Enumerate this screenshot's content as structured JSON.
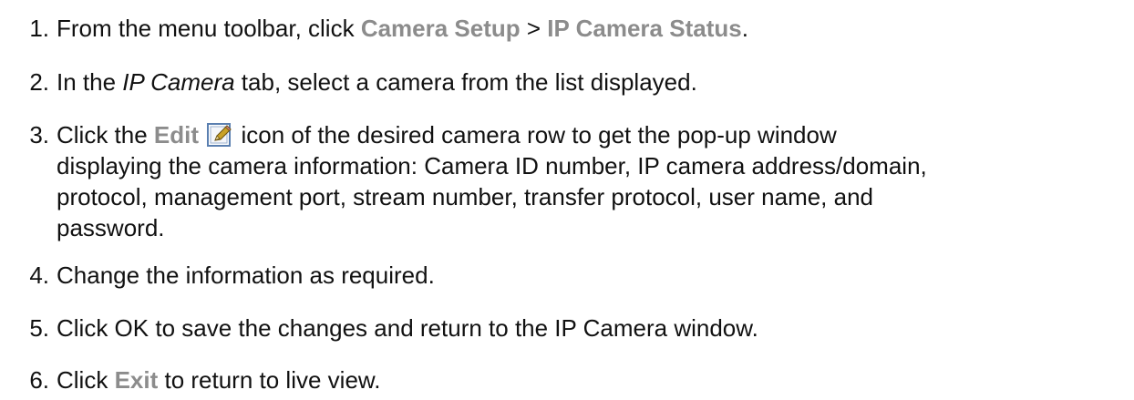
{
  "steps": [
    {
      "number": "1.",
      "pre": "From the menu toolbar, click ",
      "link1": "Camera Setup",
      "sep": " > ",
      "link2": "IP Camera Status",
      "post": "."
    },
    {
      "number": "2.",
      "pre": "In the ",
      "em": "IP Camera",
      "post": " tab, select a camera from the list displayed."
    },
    {
      "number": "3.",
      "pre": "Click the ",
      "link": "Edit",
      "icon": "edit-pencil-icon",
      "line1": " icon of the desired camera row to get the pop-up window",
      "line2": "displaying the camera information: Camera ID number, IP camera address/domain,",
      "line3": "protocol, management port, stream number, transfer protocol, user name, and",
      "line4": "password."
    },
    {
      "number": "4.",
      "text": "Change the information as required."
    },
    {
      "number": "5.",
      "text": "Click OK to save the changes and return to the IP Camera window."
    },
    {
      "number": "6.",
      "pre": "Click ",
      "link": "Exit",
      "post": " to return to live view."
    }
  ],
  "colors": {
    "text": "#111111",
    "highlight": "#8c8c8c",
    "icon_border": "#5a7fb0",
    "icon_pencil": "#c9a227"
  }
}
